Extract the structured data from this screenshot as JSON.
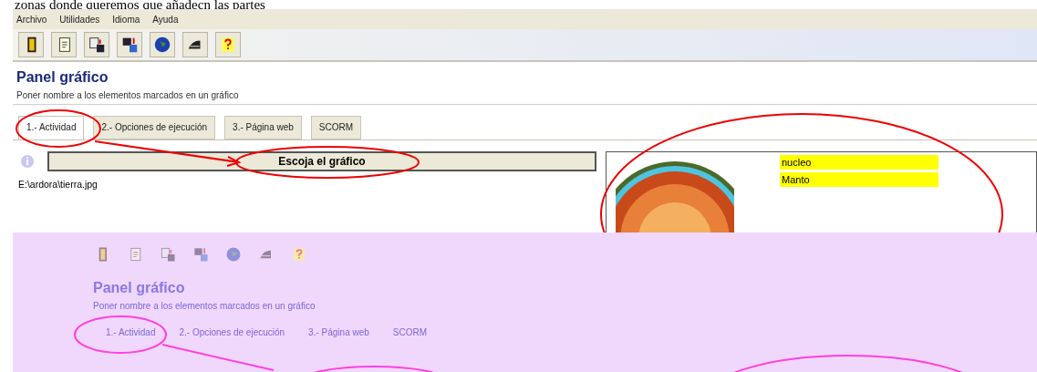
{
  "caption": "zonas donde queremos que añadecn las partes",
  "menu": [
    "Archivo",
    "Utilidades",
    "Idioma",
    "Ayuda"
  ],
  "panel": {
    "title": "Panel gráfico",
    "subtitle": "Poner nombre a los elementos marcados en un gráfico"
  },
  "tabs": [
    {
      "label": "1.- Actividad",
      "selected": true
    },
    {
      "label": "2.- Opciones de ejecución",
      "selected": false
    },
    {
      "label": "3.- Página web",
      "selected": false
    },
    {
      "label": "SCORM",
      "selected": false
    }
  ],
  "choose_button": "Escoja el gráfico",
  "file_path": "E:\\ardora\\tierra.jpg",
  "labels": [
    "nucleo",
    "Manto"
  ],
  "ghost": {
    "title": "Panel gráfico",
    "subtitle": "Poner nombre a los elementos marcados en un gráfico",
    "tabs": [
      "1.- Actividad",
      "2.- Opciones de ejecución",
      "3.- Página web",
      "SCORM"
    ]
  }
}
